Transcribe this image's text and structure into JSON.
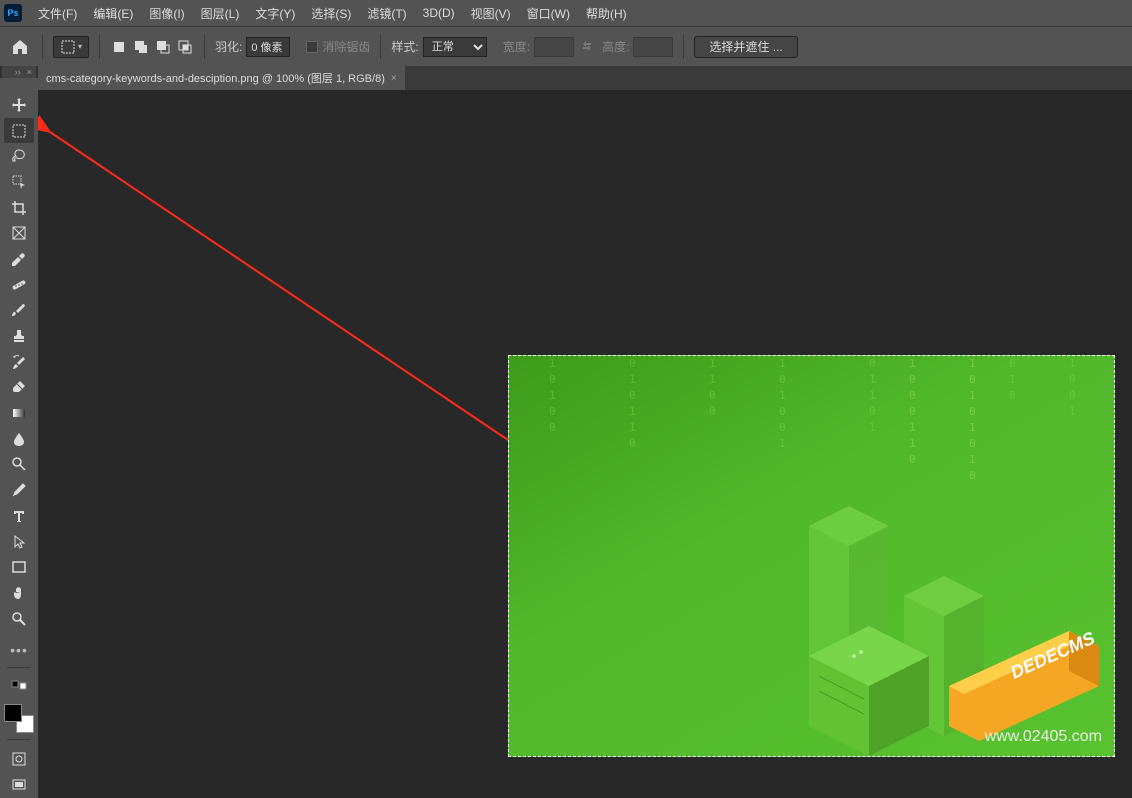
{
  "menubar": {
    "items": [
      "文件(F)",
      "编辑(E)",
      "图像(I)",
      "图层(L)",
      "文字(Y)",
      "选择(S)",
      "滤镜(T)",
      "3D(D)",
      "视图(V)",
      "窗口(W)",
      "帮助(H)"
    ]
  },
  "optionsbar": {
    "feather_label": "羽化:",
    "feather_value": "0 像素",
    "antialias_label": "消除锯齿",
    "style_label": "样式:",
    "style_value": "正常",
    "width_label": "宽度:",
    "width_value": "",
    "height_label": "高度:",
    "height_value": "",
    "mask_button": "选择并遮住 ..."
  },
  "tab": {
    "title": "cms-category-keywords-and-desciption.png @ 100% (图层 1, RGB/8)"
  },
  "tools": [
    {
      "name": "move-tool",
      "icon": "move"
    },
    {
      "name": "marquee-tool",
      "icon": "marquee",
      "active": true
    },
    {
      "name": "lasso-tool",
      "icon": "lasso"
    },
    {
      "name": "quick-select-tool",
      "icon": "wand"
    },
    {
      "name": "crop-tool",
      "icon": "crop"
    },
    {
      "name": "frame-tool",
      "icon": "frame"
    },
    {
      "name": "eyedropper-tool",
      "icon": "eyedropper"
    },
    {
      "name": "healing-tool",
      "icon": "bandage"
    },
    {
      "name": "brush-tool",
      "icon": "brush"
    },
    {
      "name": "stamp-tool",
      "icon": "stamp"
    },
    {
      "name": "history-brush-tool",
      "icon": "history"
    },
    {
      "name": "eraser-tool",
      "icon": "eraser"
    },
    {
      "name": "gradient-tool",
      "icon": "gradient"
    },
    {
      "name": "blur-tool",
      "icon": "blur"
    },
    {
      "name": "dodge-tool",
      "icon": "dodge"
    },
    {
      "name": "pen-tool",
      "icon": "pen"
    },
    {
      "name": "type-tool",
      "icon": "type"
    },
    {
      "name": "path-select-tool",
      "icon": "pathsel"
    },
    {
      "name": "rectangle-tool",
      "icon": "rect"
    },
    {
      "name": "hand-tool",
      "icon": "hand"
    },
    {
      "name": "zoom-tool",
      "icon": "zoom"
    }
  ],
  "canvas": {
    "watermark": "www.02405.com",
    "dedecms_label": "DEDECMS"
  }
}
